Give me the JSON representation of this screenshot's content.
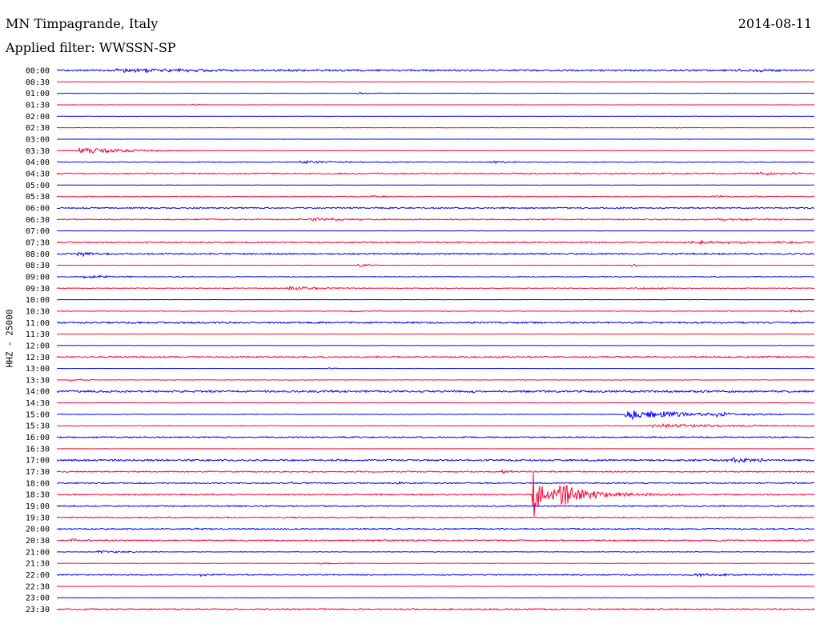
{
  "header": {
    "station": "MN Timpagrande, Italy",
    "filter": "Applied filter: WWSSN-SP",
    "date": "2014-08-11"
  },
  "chart_data": {
    "type": "line",
    "ylabel": "HHZ - 25000",
    "colors": [
      "#0000ff",
      "#ff0033"
    ],
    "rows": [
      {
        "label": "00:00",
        "color": "#0000ff",
        "noise": 1.2,
        "events": [
          {
            "x": 0.1,
            "amp": 2,
            "w": 0.15
          },
          {
            "x": 0.9,
            "amp": 2,
            "w": 0.04
          }
        ]
      },
      {
        "label": "00:30",
        "color": "#ff0033",
        "noise": 0.2,
        "events": []
      },
      {
        "label": "01:00",
        "color": "#0000ff",
        "noise": 0.3,
        "events": [
          {
            "x": 0.4,
            "amp": 1,
            "w": 0.03
          }
        ]
      },
      {
        "label": "01:30",
        "color": "#ff0033",
        "noise": 0.2,
        "events": [
          {
            "x": 0.18,
            "amp": 1,
            "w": 0.01
          }
        ]
      },
      {
        "label": "02:00",
        "color": "#0000ff",
        "noise": 0.2,
        "events": []
      },
      {
        "label": "02:30",
        "color": "#ff0033",
        "noise": 0.2,
        "events": [
          {
            "x": 0.82,
            "amp": 1,
            "w": 0.01
          }
        ]
      },
      {
        "label": "03:00",
        "color": "#0000ff",
        "noise": 0.2,
        "events": []
      },
      {
        "label": "03:30",
        "color": "#ff0033",
        "noise": 0.3,
        "events": [
          {
            "x": 0.035,
            "amp": 4,
            "w": 0.06
          }
        ]
      },
      {
        "label": "04:00",
        "color": "#0000ff",
        "noise": 0.6,
        "events": [
          {
            "x": 0.33,
            "amp": 1.5,
            "w": 0.06
          },
          {
            "x": 0.58,
            "amp": 1,
            "w": 0.03
          }
        ]
      },
      {
        "label": "04:30",
        "color": "#ff0033",
        "noise": 1.0,
        "events": [
          {
            "x": 0.93,
            "amp": 1.5,
            "w": 0.04
          }
        ]
      },
      {
        "label": "05:00",
        "color": "#0000ff",
        "noise": 0.2,
        "events": []
      },
      {
        "label": "05:30",
        "color": "#ff0033",
        "noise": 0.6,
        "events": [
          {
            "x": 0.42,
            "amp": 1,
            "w": 0.05
          },
          {
            "x": 0.87,
            "amp": 1,
            "w": 0.05
          }
        ]
      },
      {
        "label": "06:00",
        "color": "#0000ff",
        "noise": 1.0,
        "events": []
      },
      {
        "label": "06:30",
        "color": "#ff0033",
        "noise": 0.9,
        "events": [
          {
            "x": 0.34,
            "amp": 1.5,
            "w": 0.06
          },
          {
            "x": 0.88,
            "amp": 1.5,
            "w": 0.06
          }
        ]
      },
      {
        "label": "07:00",
        "color": "#0000ff",
        "noise": 0.2,
        "events": []
      },
      {
        "label": "07:30",
        "color": "#ff0033",
        "noise": 1.0,
        "events": [
          {
            "x": 0.85,
            "amp": 1.5,
            "w": 0.12
          }
        ]
      },
      {
        "label": "08:00",
        "color": "#0000ff",
        "noise": 1.1,
        "events": [
          {
            "x": 0.03,
            "amp": 2.5,
            "w": 0.02
          }
        ]
      },
      {
        "label": "08:30",
        "color": "#ff0033",
        "noise": 0.3,
        "events": [
          {
            "x": 0.4,
            "amp": 1.5,
            "w": 0.02
          },
          {
            "x": 0.76,
            "amp": 2,
            "w": 0.01
          }
        ]
      },
      {
        "label": "09:00",
        "color": "#0000ff",
        "noise": 0.6,
        "events": [
          {
            "x": 0.04,
            "amp": 1.5,
            "w": 0.05
          }
        ]
      },
      {
        "label": "09:30",
        "color": "#ff0033",
        "noise": 0.5,
        "events": [
          {
            "x": 0.31,
            "amp": 2.5,
            "w": 0.04
          },
          {
            "x": 0.77,
            "amp": 1,
            "w": 0.04
          }
        ]
      },
      {
        "label": "10:00",
        "color": "#0000ff",
        "noise": 0.2,
        "events": []
      },
      {
        "label": "10:30",
        "color": "#ff0033",
        "noise": 0.4,
        "events": [
          {
            "x": 0.39,
            "amp": 1,
            "w": 0.02
          },
          {
            "x": 0.97,
            "amp": 1.5,
            "w": 0.02
          }
        ]
      },
      {
        "label": "11:00",
        "color": "#0000ff",
        "noise": 1.2,
        "events": []
      },
      {
        "label": "11:30",
        "color": "#ff0033",
        "noise": 0.2,
        "events": []
      },
      {
        "label": "12:00",
        "color": "#0000ff",
        "noise": 0.3,
        "events": []
      },
      {
        "label": "12:30",
        "color": "#ff0033",
        "noise": 1.1,
        "events": []
      },
      {
        "label": "13:00",
        "color": "#0000ff",
        "noise": 0.2,
        "events": [
          {
            "x": 0.36,
            "amp": 1,
            "w": 0.01
          }
        ]
      },
      {
        "label": "13:30",
        "color": "#ff0033",
        "noise": 0.4,
        "events": [
          {
            "x": 0.02,
            "amp": 1.5,
            "w": 0.02
          }
        ]
      },
      {
        "label": "14:00",
        "color": "#0000ff",
        "noise": 1.5,
        "events": [
          {
            "x": 0.55,
            "amp": 2,
            "w": 0.01
          }
        ]
      },
      {
        "label": "14:30",
        "color": "#ff0033",
        "noise": 0.2,
        "events": []
      },
      {
        "label": "15:00",
        "color": "#0000ff",
        "noise": 0.5,
        "events": [
          {
            "x": 0.76,
            "amp": 6,
            "w": 0.07
          },
          {
            "x": 0.87,
            "amp": 2,
            "w": 0.04
          }
        ]
      },
      {
        "label": "15:30",
        "color": "#ff0033",
        "noise": 0.5,
        "events": [
          {
            "x": 0.8,
            "amp": 2,
            "w": 0.12
          }
        ]
      },
      {
        "label": "16:00",
        "color": "#0000ff",
        "noise": 1.0,
        "events": []
      },
      {
        "label": "16:30",
        "color": "#ff0033",
        "noise": 0.2,
        "events": []
      },
      {
        "label": "17:00",
        "color": "#0000ff",
        "noise": 1.3,
        "events": [
          {
            "x": 0.89,
            "amp": 3,
            "w": 0.04
          }
        ]
      },
      {
        "label": "17:30",
        "color": "#ff0033",
        "noise": 0.9,
        "events": [
          {
            "x": 0.59,
            "amp": 1.5,
            "w": 0.02
          }
        ]
      },
      {
        "label": "18:00",
        "color": "#0000ff",
        "noise": 0.9,
        "events": [
          {
            "x": 0.31,
            "amp": 2,
            "w": 0.01
          },
          {
            "x": 0.45,
            "amp": 1.5,
            "w": 0.01
          }
        ]
      },
      {
        "label": "18:30",
        "color": "#ff0033",
        "noise": 1.0,
        "events": [
          {
            "x": 0.627,
            "amp": 38,
            "w": 0.012,
            "tail": 0.06
          },
          {
            "x": 0.67,
            "amp": 10,
            "w": 0.05
          }
        ]
      },
      {
        "label": "19:00",
        "color": "#0000ff",
        "noise": 1.0,
        "events": []
      },
      {
        "label": "19:30",
        "color": "#ff0033",
        "noise": 0.9,
        "events": []
      },
      {
        "label": "20:00",
        "color": "#0000ff",
        "noise": 1.0,
        "events": [
          {
            "x": 0.18,
            "amp": 1,
            "w": 0.01
          }
        ]
      },
      {
        "label": "20:30",
        "color": "#ff0033",
        "noise": 1.0,
        "events": [
          {
            "x": 0.02,
            "amp": 2,
            "w": 0.02
          }
        ]
      },
      {
        "label": "21:00",
        "color": "#0000ff",
        "noise": 0.4,
        "events": [
          {
            "x": 0.06,
            "amp": 1.5,
            "w": 0.05
          }
        ]
      },
      {
        "label": "21:30",
        "color": "#ff0033",
        "noise": 0.3,
        "events": [
          {
            "x": 0.35,
            "amp": 1,
            "w": 0.03
          }
        ]
      },
      {
        "label": "22:00",
        "color": "#0000ff",
        "noise": 0.9,
        "events": [
          {
            "x": 0.19,
            "amp": 1.5,
            "w": 0.03
          },
          {
            "x": 0.85,
            "amp": 1.5,
            "w": 0.05
          }
        ]
      },
      {
        "label": "22:30",
        "color": "#ff0033",
        "noise": 0.2,
        "events": []
      },
      {
        "label": "23:00",
        "color": "#0000ff",
        "noise": 0.3,
        "events": []
      },
      {
        "label": "23:30",
        "color": "#ff0033",
        "noise": 1.0,
        "events": []
      }
    ]
  }
}
